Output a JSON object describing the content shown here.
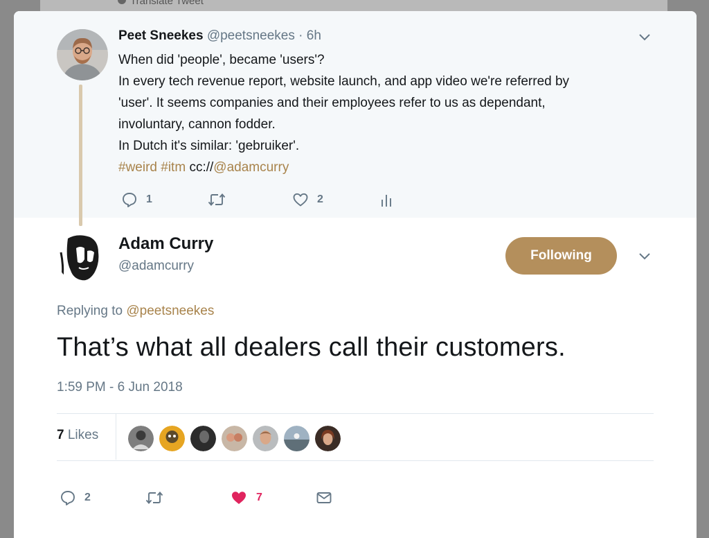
{
  "background": {
    "previous_label": "Translate Tweet"
  },
  "parent_tweet": {
    "name": "Peet Sneekes",
    "handle": "@peetsneekes",
    "separator": "·",
    "age": "6h",
    "text_lines": [
      "When did 'people', became 'users'?",
      "In every tech revenue report, website launch, and app video we're referred by",
      "'user'. It seems companies and their employees refer to us as dependant,",
      "involuntary, cannon fodder.",
      "In Dutch it's similar: 'gebruiker'."
    ],
    "tags": {
      "hashtag1": "#weird",
      "hashtag2": "#itm",
      "cc_prefix": "cc://",
      "mention": "@adamcurry"
    },
    "actions": {
      "reply_count": "1",
      "retweet_count": "",
      "like_count": "2"
    }
  },
  "reply_tweet": {
    "name": "Adam Curry",
    "handle": "@adamcurry",
    "follow_label": "Following",
    "replying_prefix": "Replying to",
    "replying_to": "@peetsneekes",
    "text": "That’s what all dealers call their customers.",
    "timestamp": "1:59 PM - 6 Jun 2018",
    "likes": {
      "count": "7",
      "label": "Likes"
    },
    "actions": {
      "reply_count": "2",
      "retweet_count": "",
      "like_count": "7"
    }
  },
  "colors": {
    "accent": "#b48f5c",
    "link": "#a8834b",
    "like_red": "#e0245e",
    "muted": "#657786"
  }
}
